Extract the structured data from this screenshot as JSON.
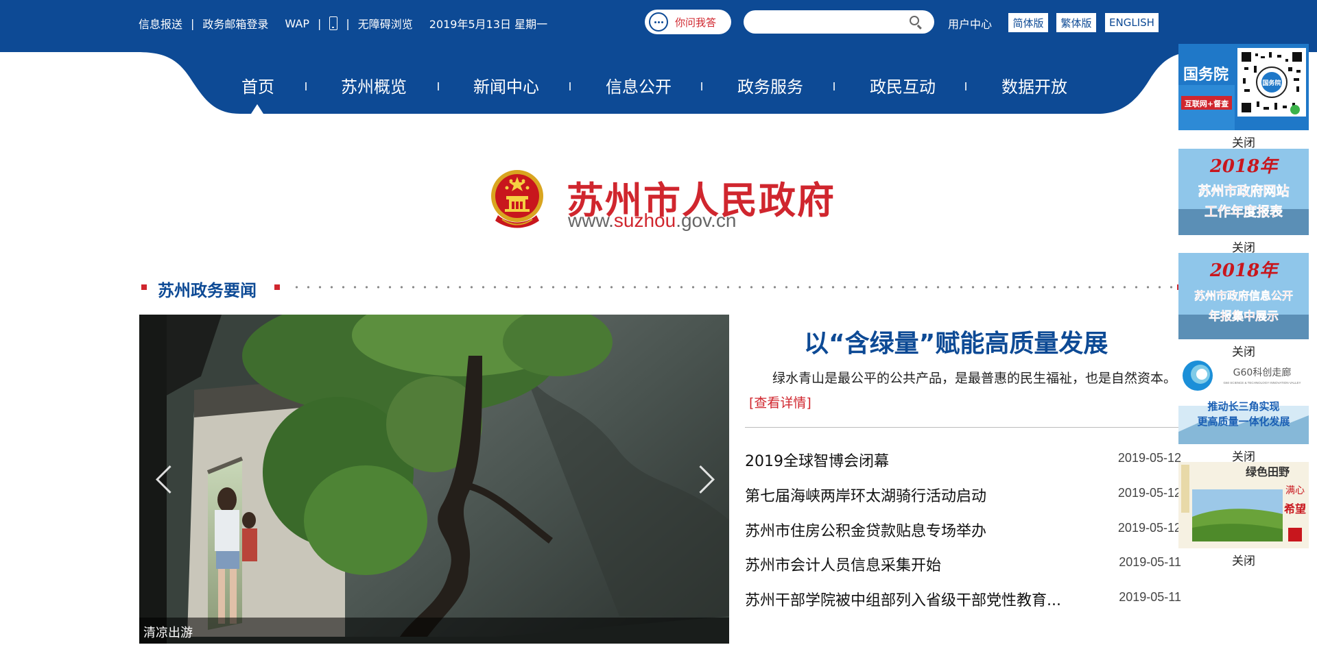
{
  "topbar": {
    "links": [
      "信息报送",
      "政务邮箱登录",
      "WAP",
      "无障碍浏览"
    ],
    "date": "2019年5月13日 星期一",
    "ask_label": "你问我答",
    "search_placeholder": "",
    "user_center": "用户中心",
    "languages": [
      "简体版",
      "繁体版",
      "ENGLISH"
    ]
  },
  "nav": {
    "items": [
      "首页",
      "苏州概览",
      "新闻中心",
      "信息公开",
      "政务服务",
      "政民互动",
      "数据开放"
    ],
    "active_index": 0
  },
  "logo": {
    "title": "苏州市人民政府",
    "url_prefix": "www.",
    "url_accent": "suzhou",
    "url_suffix": ".gov.cn"
  },
  "section": {
    "title": "苏州政务要闻"
  },
  "carousel": {
    "caption": "清凉出游"
  },
  "headline": {
    "title": "以“含绿量”赋能高质量发展",
    "summary": "绿水青山是最公平的公共产品，是最普惠的民生福祉，也是自然资本。",
    "more": "[查看详情]"
  },
  "news": [
    {
      "title": "2019全球智博会闭幕",
      "date": "2019-05-12"
    },
    {
      "title": "第七届海峡两岸环太湖骑行活动启动",
      "date": "2019-05-12"
    },
    {
      "title": "苏州市住房公积金贷款贴息专场举办",
      "date": "2019-05-12"
    },
    {
      "title": "苏州市会计人员信息采集开始",
      "date": "2019-05-11"
    },
    {
      "title": "苏州干部学院被中组部列入省级干部党性教育...",
      "date": "2019-05-11"
    }
  ],
  "ads": {
    "close_label": "关闭",
    "ad1": {
      "line1": "国务院",
      "line2": "互联网+督查",
      "qr_label": "国务院"
    },
    "ad2": {
      "year": "2018年",
      "line1": "苏州市政府网站",
      "line2": "工作年度报表"
    },
    "ad3": {
      "year": "2018年",
      "line1": "苏州市政府信息公开",
      "line2": "年报集中展示"
    },
    "ad4": {
      "title": "G60科创走廊",
      "sub": "G60 SCIENCE & TECHNOLOGY INNOVATION VALLEY",
      "line1": "推动长三角实现",
      "line2": "更高质量一体化发展"
    },
    "ad5": {
      "title": "绿色田野",
      "line1": "满心",
      "line2": "希望"
    }
  },
  "colors": {
    "brand_blue": "#0d4a95",
    "brand_red": "#d0262e"
  }
}
